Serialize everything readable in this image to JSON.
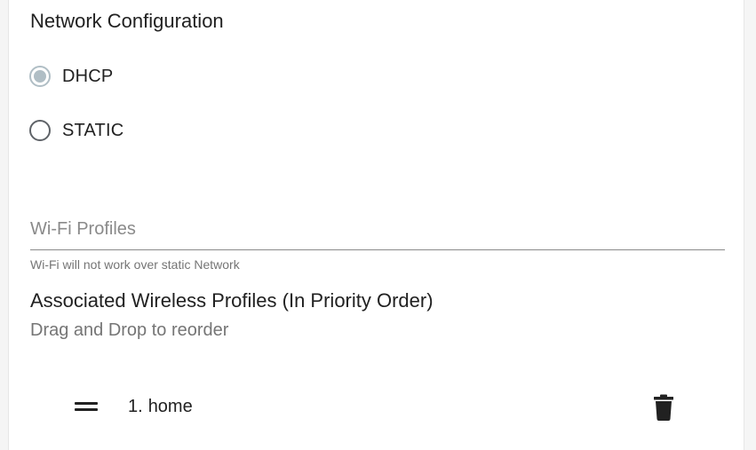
{
  "network": {
    "title": "Network Configuration",
    "options": [
      {
        "label": "DHCP",
        "checked": true
      },
      {
        "label": "STATIC",
        "checked": false
      }
    ]
  },
  "wifi": {
    "field_placeholder": "Wi-Fi Profiles",
    "helper": "Wi-Fi will not work over static Network"
  },
  "associated": {
    "title": "Associated Wireless Profiles (In Priority Order)",
    "subtitle": "Drag and Drop to reorder",
    "profiles": [
      {
        "index": "1.",
        "name": "home"
      }
    ]
  },
  "icons": {
    "drag": "drag-handle-icon",
    "delete": "trash-icon"
  },
  "colors": {
    "radio_checked": "#b0bec5",
    "radio_unchecked": "#5f6368"
  }
}
